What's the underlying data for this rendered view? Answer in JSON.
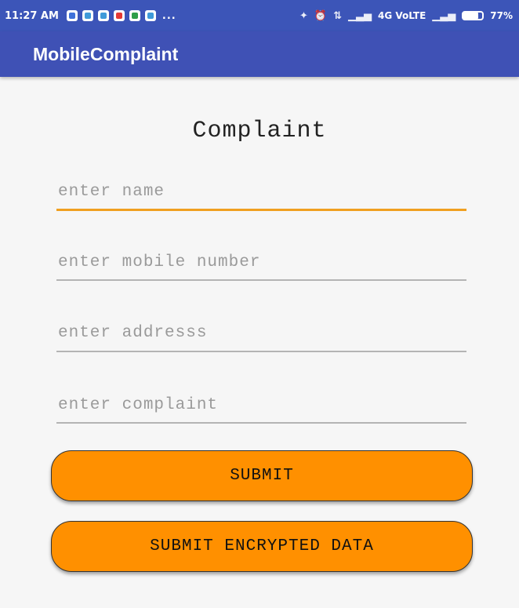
{
  "status_bar": {
    "time": "11:27 AM",
    "more": "...",
    "network": "4G VoLTE",
    "battery_label": "77%",
    "battery_level": 0.77,
    "notification_icons": [
      "sms-icon",
      "message-icon",
      "fi-icon",
      "jio-icon",
      "phone-icon",
      "uc-icon"
    ],
    "system_icons": [
      "vibrate-icon",
      "alarm-icon",
      "data-arrows-icon",
      "signal-icon",
      "signal-icon",
      "battery-icon"
    ]
  },
  "app_bar": {
    "title": "MobileComplaint"
  },
  "form": {
    "heading": "Complaint",
    "name_placeholder": "enter name",
    "mobile_placeholder": "enter mobile number",
    "address_placeholder": "enter addresss",
    "complaint_placeholder": "enter complaint",
    "submit_label": "SUBMIT",
    "submit_encrypted_label": "SUBMIT ENCRYPTED DATA"
  },
  "colors": {
    "app_bar": "#3f51b5",
    "status_bar": "#3c55b8",
    "button": "#ff9000",
    "focus_underline": "#f0a020"
  }
}
